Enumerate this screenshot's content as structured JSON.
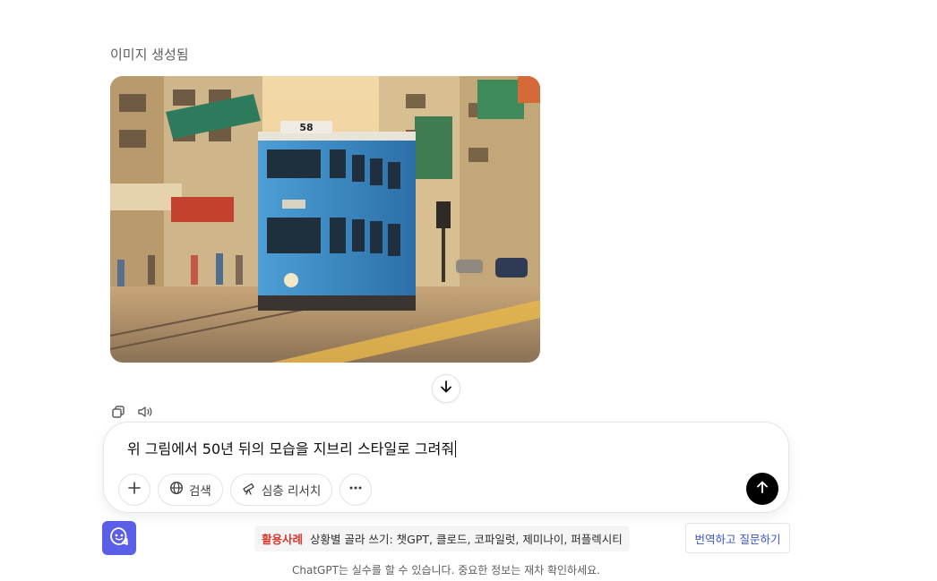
{
  "message": {
    "generated_label": "이미지 생성됨",
    "image_icon": "generated-tram-illustration",
    "tram": {
      "route_number": "58"
    }
  },
  "actions": {
    "copy_icon": "copy-icon",
    "read_aloud_icon": "speaker-icon",
    "scroll_icon": "arrow-down-icon"
  },
  "composer": {
    "input_value": "위 그림에서 50년 뒤의 모습을 지브리 스타일로 그려줘",
    "tools": {
      "add_icon": "plus-icon",
      "search_label": "검색",
      "search_icon": "globe-icon",
      "research_label": "심층 리서치",
      "research_icon": "telescope-icon",
      "more_icon": "ellipsis-icon"
    },
    "send_icon": "arrow-up-icon"
  },
  "extension": {
    "icon": "chat-bubble-icon",
    "color": "#5b5fe8"
  },
  "banner": {
    "tag": "활용사례",
    "text": "상황별 골라 쓰기: 챗GPT, 클로드, 코파일럿, 제미나이, 퍼플렉시티",
    "tag_color": "#d9362b"
  },
  "translate_button": {
    "label": "번역하고 질문하기",
    "color": "#3a53c4"
  },
  "footer": {
    "disclaimer": "ChatGPT는 실수를 할 수 있습니다. 중요한 정보는 재차 확인하세요."
  }
}
